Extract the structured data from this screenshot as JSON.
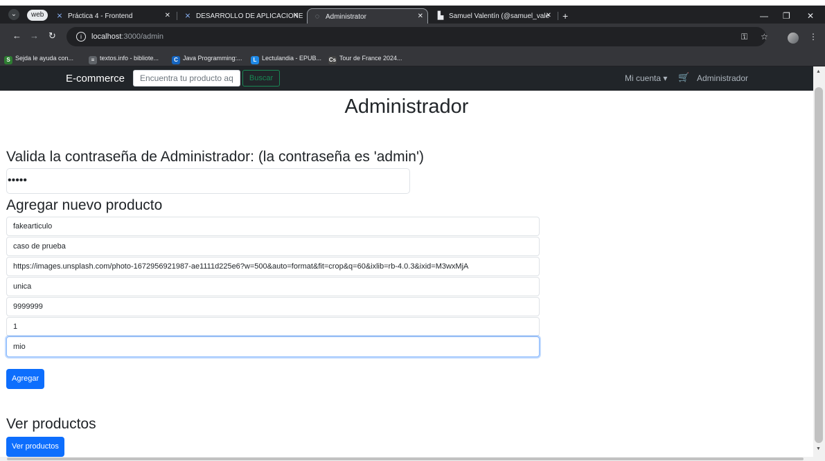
{
  "browser": {
    "profile": "web",
    "tabs": [
      {
        "title": "Práctica 4 - Frontend",
        "icon": "⨯"
      },
      {
        "title": "DESARROLLO DE APLICACIONE",
        "icon": "⨯"
      },
      {
        "title": "Administrator",
        "icon": "◌"
      },
      {
        "title": "Samuel Valentín (@samuel_vale",
        "icon": "▙"
      }
    ],
    "new_tab": "+",
    "url_host": "localhost",
    "url_path": ":3000/admin",
    "bookmarks": [
      {
        "label": "Sejda le ayuda con...",
        "icon": "S",
        "color": "#2e7d32"
      },
      {
        "label": "textos.info - bibliote...",
        "icon": "≡",
        "color": "#5f6368"
      },
      {
        "label": "Java Programming:...",
        "icon": "C",
        "color": "#1565c0"
      },
      {
        "label": "Lectulandia - EPUB...",
        "icon": "L",
        "color": "#1e88e5"
      },
      {
        "label": "Tour de France 2024...",
        "icon": "Cs",
        "color": "#424242"
      }
    ]
  },
  "navbar": {
    "brand": "E-commerce",
    "search_placeholder": "Encuentra tu producto aq",
    "search_button": "Buscar",
    "account": "Mi cuenta ▾",
    "cart_icon": "🛒",
    "admin": "Administrador"
  },
  "main": {
    "title": "Administrador",
    "password_heading": "Valida la contraseña de Administrador: (la contraseña es 'admin')",
    "password_value": "•••••",
    "add_heading": "Agregar nuevo producto",
    "fields": [
      "fakearticulo",
      "caso de prueba",
      "https://images.unsplash.com/photo-1672956921987-ae1111d225e6?w=500&auto=format&fit=crop&q=60&ixlib=rb-4.0.3&ixid=M3wxMjA",
      "unica",
      "9999999",
      "1",
      "mio"
    ],
    "add_button": "Agregar",
    "view_heading": "Ver productos",
    "view_button": "Ver productos"
  }
}
